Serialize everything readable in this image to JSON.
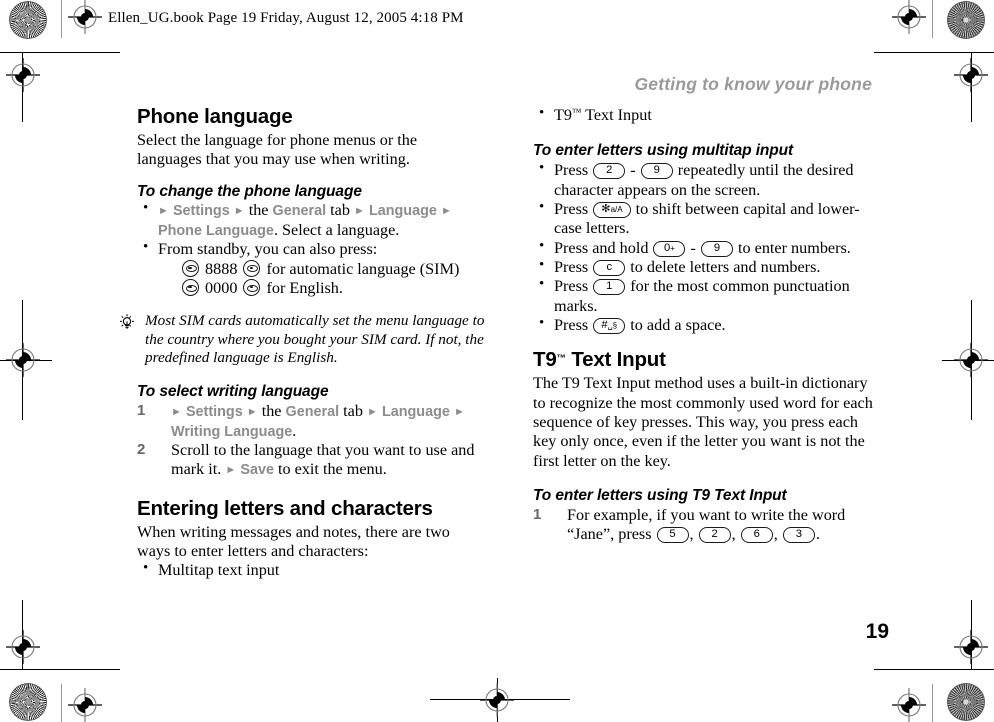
{
  "slugline": "Ellen_UG.book  Page 19  Friday, August 12, 2005  4:18 PM",
  "running_header": "Getting to know your phone",
  "page_number": "19",
  "colors": {
    "nav_keyword": "#8c8c8c",
    "running_header": "#9a9a9a",
    "step_number": "#666666"
  },
  "left_column": {
    "section_title": "Phone language",
    "intro": "Select the language for phone menus or the languages that you may use when writing.",
    "procedure_1": {
      "heading": "To change the phone language",
      "bullet_1": {
        "nav": [
          "Settings",
          "General",
          "Language",
          "Phone Language"
        ],
        "word_the": "the",
        "word_tab": "tab",
        "tail": ". Select a language."
      },
      "bullet_2": {
        "text": "From standby, you can also press:",
        "sub_1_digits": "8888",
        "sub_1_tail": "for automatic language (SIM)",
        "sub_2_digits": "0000",
        "sub_2_tail": "for English."
      }
    },
    "tip": "Most SIM cards automatically set the menu language to the country where you bought your SIM card. If not, the predefined language is English.",
    "procedure_2": {
      "heading": "To select writing language",
      "step_1": {
        "nav": [
          "Settings",
          "General",
          "Language",
          "Writing Language"
        ],
        "word_the": "the",
        "word_tab": "tab",
        "tail": "."
      },
      "step_2": {
        "text_before": "Scroll to the language that you want to use and mark it.",
        "nav_save": "Save",
        "text_after": "to exit the menu."
      }
    },
    "section_title_2": "Entering letters and characters",
    "intro_2": "When writing messages and notes, there are two ways to enter letters and characters:",
    "bullet_multitap": "Multitap text input"
  },
  "right_column": {
    "bullet_t9": {
      "label": "T9",
      "tm": "™",
      "tail": "Text Input"
    },
    "procedure_multitap": {
      "heading": "To enter letters using multitap input",
      "bullets": [
        {
          "before": "Press",
          "key1": "2",
          "dash": "-",
          "key2": "9",
          "after": "repeatedly until the desired character appears on the screen."
        },
        {
          "before": "Press",
          "key1": "✻",
          "key1_mini": "a/A",
          "after": "to shift between capital and lower-case letters."
        },
        {
          "before": "Press and hold",
          "key1": "0",
          "key1_mini": "+",
          "dash": "-",
          "key2": "9",
          "after": "to enter numbers."
        },
        {
          "before": "Press",
          "key1": "c",
          "after": "to delete letters and numbers."
        },
        {
          "before": "Press",
          "key1": "1",
          "after": "for the most common punctuation marks."
        },
        {
          "before": "Press",
          "key1": "#",
          "key1_mini": "␣§",
          "after": "to add a space."
        }
      ]
    },
    "section_t9": {
      "title": "T9",
      "title_tm": "™",
      "title_tail": "Text Input",
      "body": "The T9 Text Input method uses a built-in dictionary to recognize the most commonly used word for each sequence of key presses. This way, you press each key only once, even if the letter you want is not the first letter on the key."
    },
    "procedure_t9": {
      "heading": "To enter letters using T9 Text Input",
      "step_1_before": "For example, if you want to write the word “Jane”, press",
      "keys": [
        "5",
        "2",
        "6",
        "3"
      ],
      "step_1_after": "."
    }
  }
}
